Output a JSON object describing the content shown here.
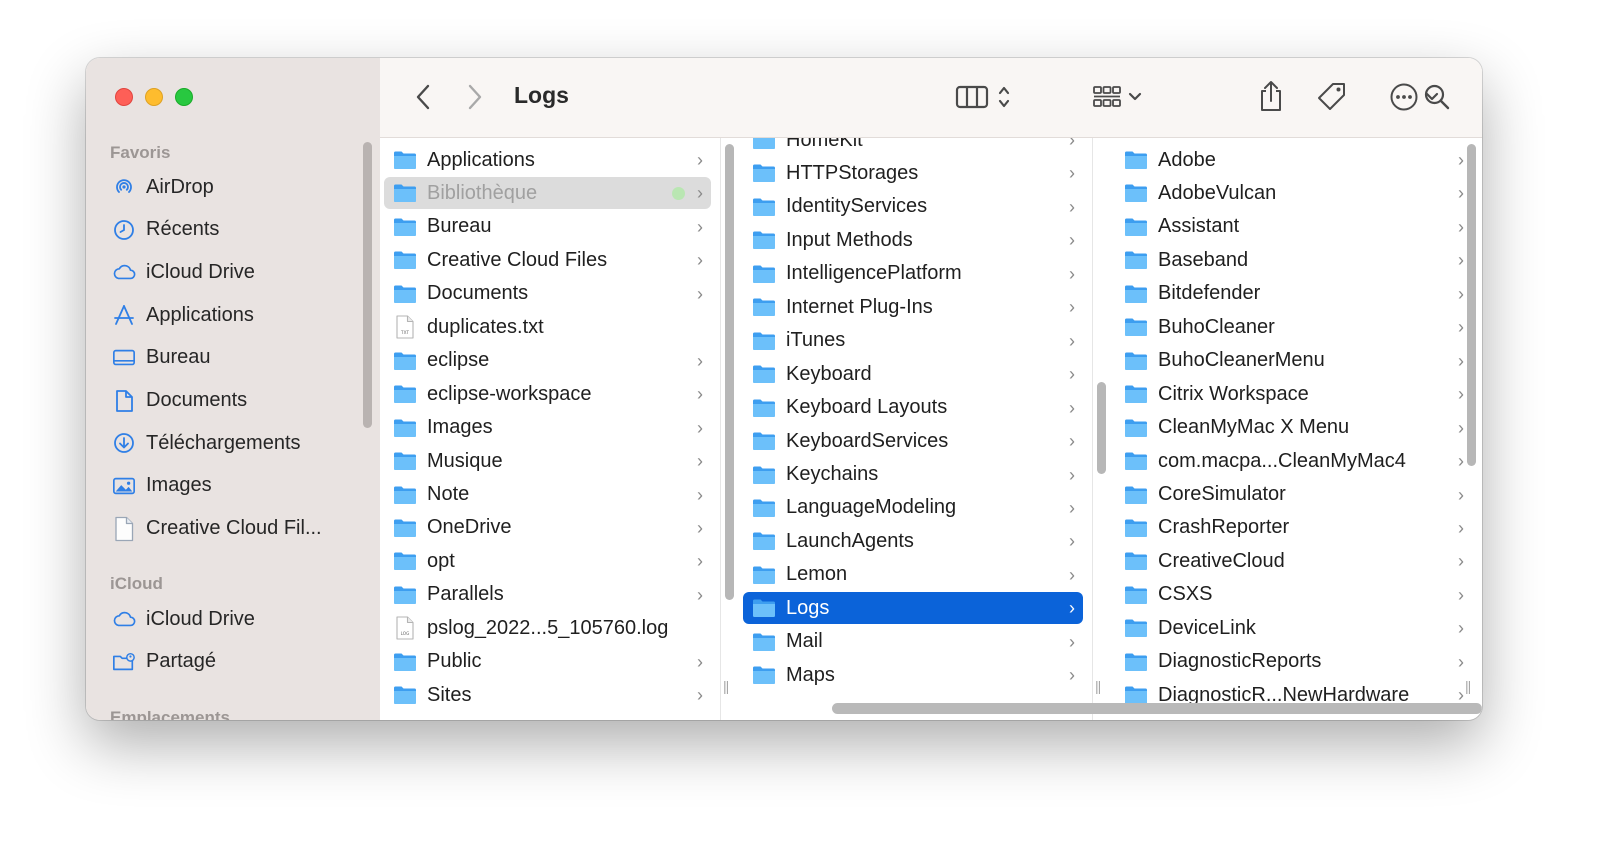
{
  "window": {
    "title": "Logs"
  },
  "colors": {
    "accent": "#0b63d9",
    "folder": "#5fb4f5",
    "tag_green": "#b9e6b2"
  },
  "sidebar": {
    "sections": [
      {
        "label": "Favoris"
      },
      {
        "label": "iCloud"
      },
      {
        "label": "Emplacements"
      }
    ],
    "favorites": [
      {
        "label": "AirDrop",
        "icon": "airdrop-icon"
      },
      {
        "label": "Récents",
        "icon": "clock-icon"
      },
      {
        "label": "iCloud Drive",
        "icon": "cloud-icon"
      },
      {
        "label": "Applications",
        "icon": "applications-icon"
      },
      {
        "label": "Bureau",
        "icon": "desktop-icon"
      },
      {
        "label": "Documents",
        "icon": "document-icon"
      },
      {
        "label": "Téléchargements",
        "icon": "download-icon"
      },
      {
        "label": "Images",
        "icon": "image-icon"
      },
      {
        "label": "Creative Cloud Fil...",
        "icon": "file-icon"
      }
    ],
    "icloud": [
      {
        "label": "iCloud Drive",
        "icon": "cloud-icon"
      },
      {
        "label": "Partagé",
        "icon": "shared-folder-icon"
      }
    ]
  },
  "columns": [
    {
      "items": [
        {
          "label": "Applications",
          "kind": "folder",
          "chevron": true
        },
        {
          "label": "Bibliothèque",
          "kind": "folder",
          "chevron": true,
          "state": "selected-inactive",
          "tag": "green"
        },
        {
          "label": "Bureau",
          "kind": "folder",
          "chevron": true
        },
        {
          "label": "Creative Cloud Files",
          "kind": "folder",
          "chevron": true
        },
        {
          "label": "Documents",
          "kind": "folder",
          "chevron": true
        },
        {
          "label": "duplicates.txt",
          "kind": "file",
          "badge": "TXT",
          "chevron": false
        },
        {
          "label": "eclipse",
          "kind": "folder",
          "chevron": true
        },
        {
          "label": "eclipse-workspace",
          "kind": "folder",
          "chevron": true
        },
        {
          "label": "Images",
          "kind": "folder",
          "chevron": true
        },
        {
          "label": "Musique",
          "kind": "folder",
          "chevron": true
        },
        {
          "label": "Note",
          "kind": "folder",
          "chevron": true
        },
        {
          "label": "OneDrive",
          "kind": "folder",
          "chevron": true
        },
        {
          "label": "opt",
          "kind": "folder",
          "chevron": true
        },
        {
          "label": "Parallels",
          "kind": "folder",
          "chevron": true
        },
        {
          "label": "pslog_2022...5_105760.log",
          "kind": "file",
          "badge": "LOG",
          "chevron": false
        },
        {
          "label": "Public",
          "kind": "folder",
          "chevron": true
        },
        {
          "label": "Sites",
          "kind": "folder",
          "chevron": true
        }
      ]
    },
    {
      "items": [
        {
          "label": "HomeKit",
          "kind": "folder",
          "chevron": true
        },
        {
          "label": "HTTPStorages",
          "kind": "folder",
          "chevron": true
        },
        {
          "label": "IdentityServices",
          "kind": "folder",
          "chevron": true
        },
        {
          "label": "Input Methods",
          "kind": "folder",
          "chevron": true
        },
        {
          "label": "IntelligencePlatform",
          "kind": "folder",
          "chevron": true
        },
        {
          "label": "Internet Plug-Ins",
          "kind": "folder",
          "chevron": true
        },
        {
          "label": "iTunes",
          "kind": "folder",
          "chevron": true
        },
        {
          "label": "Keyboard",
          "kind": "folder",
          "chevron": true
        },
        {
          "label": "Keyboard Layouts",
          "kind": "folder",
          "chevron": true
        },
        {
          "label": "KeyboardServices",
          "kind": "folder",
          "chevron": true
        },
        {
          "label": "Keychains",
          "kind": "folder",
          "chevron": true
        },
        {
          "label": "LanguageModeling",
          "kind": "folder",
          "chevron": true
        },
        {
          "label": "LaunchAgents",
          "kind": "folder",
          "chevron": true
        },
        {
          "label": "Lemon",
          "kind": "folder",
          "chevron": true
        },
        {
          "label": "Logs",
          "kind": "folder",
          "chevron": true,
          "state": "selected"
        },
        {
          "label": "Mail",
          "kind": "folder",
          "chevron": true
        },
        {
          "label": "Maps",
          "kind": "folder",
          "chevron": true
        }
      ]
    },
    {
      "items": [
        {
          "label": "Adobe",
          "kind": "folder",
          "chevron": true
        },
        {
          "label": "AdobeVulcan",
          "kind": "folder",
          "chevron": true
        },
        {
          "label": "Assistant",
          "kind": "folder",
          "chevron": true
        },
        {
          "label": "Baseband",
          "kind": "folder",
          "chevron": true
        },
        {
          "label": "Bitdefender",
          "kind": "folder",
          "chevron": true
        },
        {
          "label": "BuhoCleaner",
          "kind": "folder",
          "chevron": true
        },
        {
          "label": "BuhoCleanerMenu",
          "kind": "folder",
          "chevron": true
        },
        {
          "label": "Citrix Workspace",
          "kind": "folder",
          "chevron": true
        },
        {
          "label": "CleanMyMac X Menu",
          "kind": "folder",
          "chevron": true
        },
        {
          "label": "com.macpa...CleanMyMac4",
          "kind": "folder",
          "chevron": true
        },
        {
          "label": "CoreSimulator",
          "kind": "folder",
          "chevron": true
        },
        {
          "label": "CrashReporter",
          "kind": "folder",
          "chevron": true
        },
        {
          "label": "CreativeCloud",
          "kind": "folder",
          "chevron": true
        },
        {
          "label": "CSXS",
          "kind": "folder",
          "chevron": true
        },
        {
          "label": "DeviceLink",
          "kind": "folder",
          "chevron": true
        },
        {
          "label": "DiagnosticReports",
          "kind": "folder",
          "chevron": true
        },
        {
          "label": "DiagnosticR...NewHardware",
          "kind": "folder",
          "chevron": true
        }
      ]
    }
  ],
  "toolbar": {
    "icons": [
      "back-icon",
      "forward-icon",
      "column-view-icon",
      "group-icon",
      "share-icon",
      "tag-icon",
      "more-icon",
      "search-icon"
    ]
  }
}
